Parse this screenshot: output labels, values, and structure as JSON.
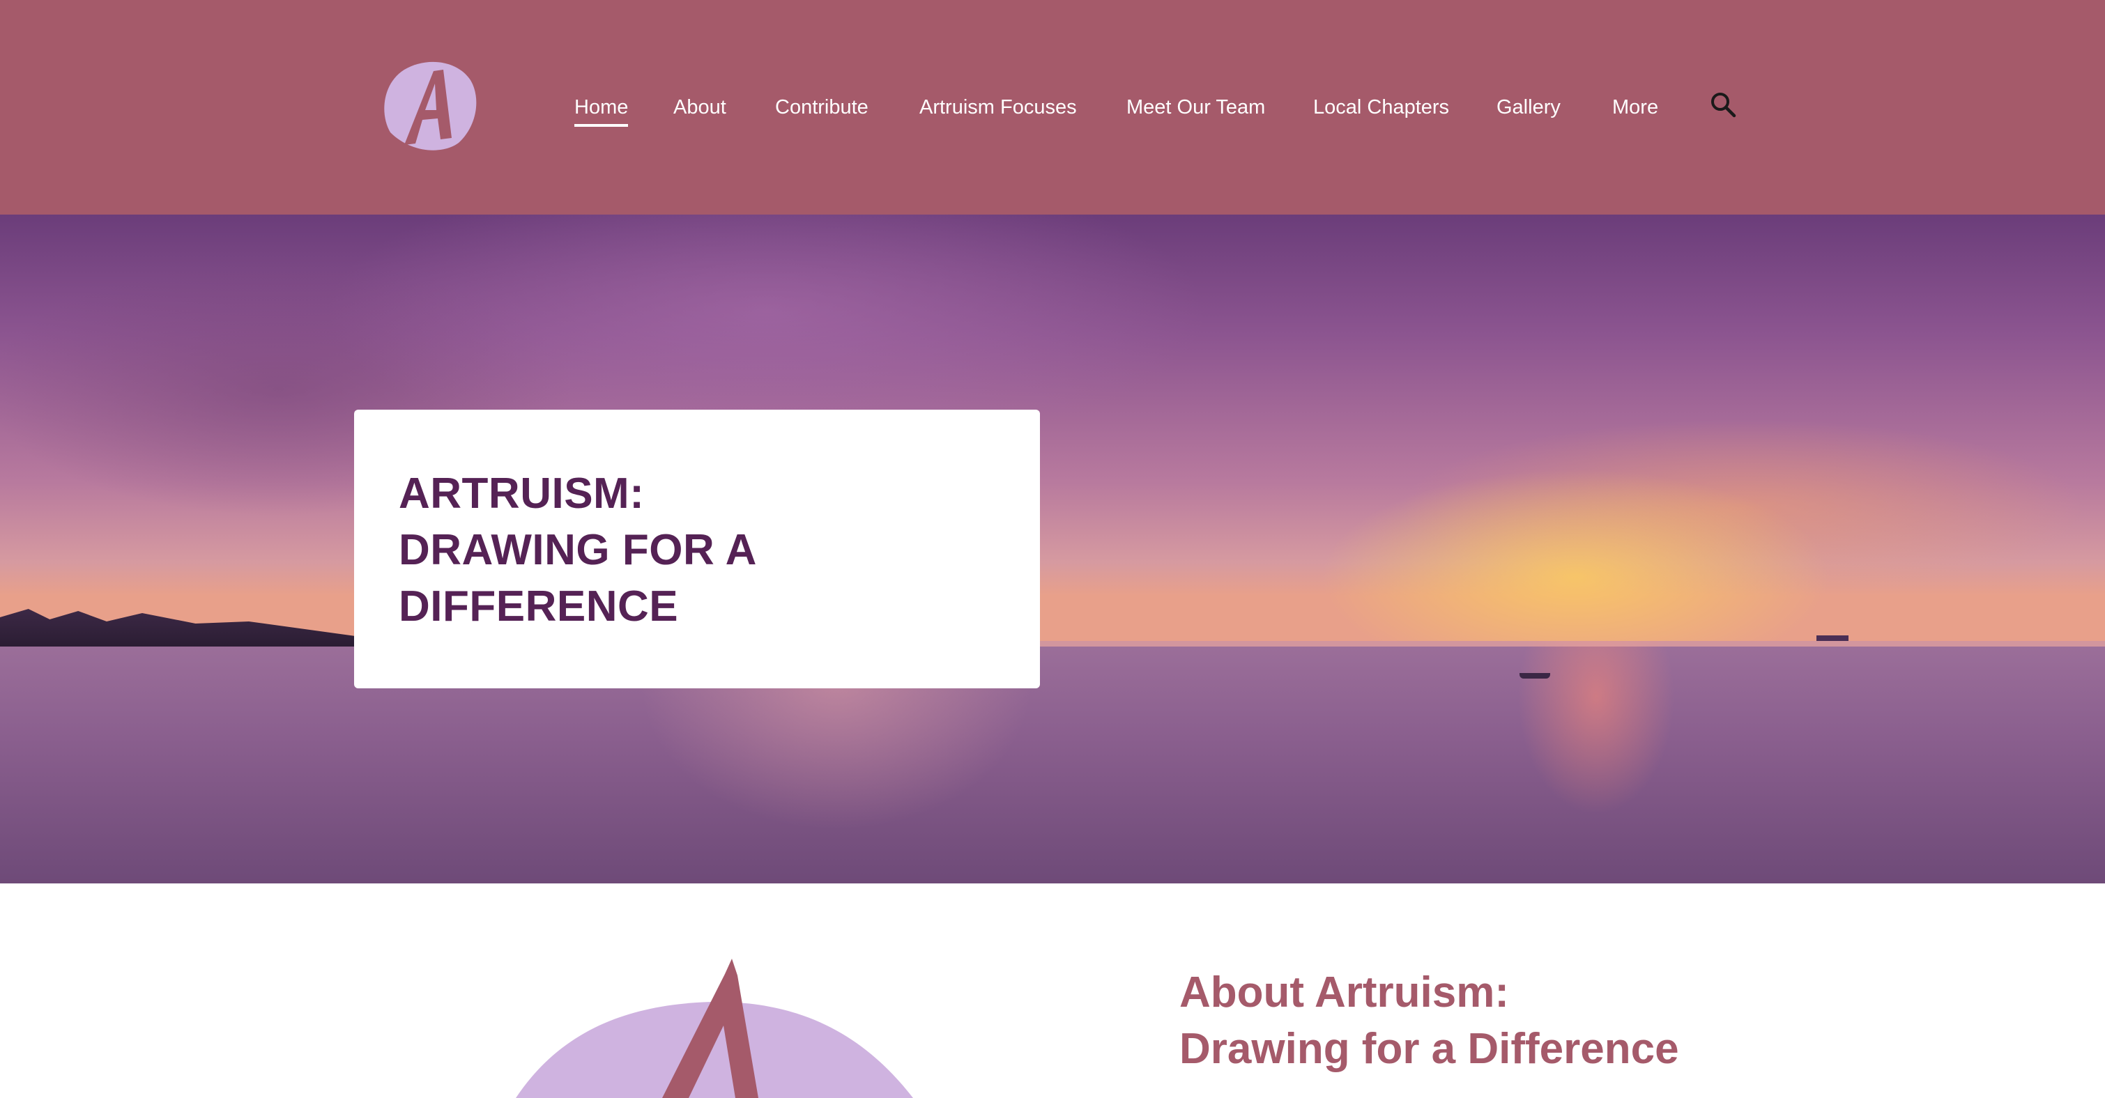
{
  "header": {
    "logo_icon": "artruism-a-logo-icon",
    "nav": {
      "home": "Home",
      "about": "About",
      "contribute": "Contribute",
      "focuses": "Artruism Focuses",
      "team": "Meet Our Team",
      "chapters": "Local Chapters",
      "gallery": "Gallery",
      "more": "More"
    },
    "active_nav": "Home",
    "search_icon": "search-icon"
  },
  "hero": {
    "title": "ARTRUISM:\nDRAWING FOR A\nDIFFERENCE"
  },
  "about": {
    "graphic_icon": "artruism-a-logo-icon",
    "title": "About Artruism:\nDrawing for a Difference"
  },
  "colors": {
    "brand": "#a55a6a",
    "hero_title": "#552255",
    "logo_lavender": "#cfb3e0"
  }
}
